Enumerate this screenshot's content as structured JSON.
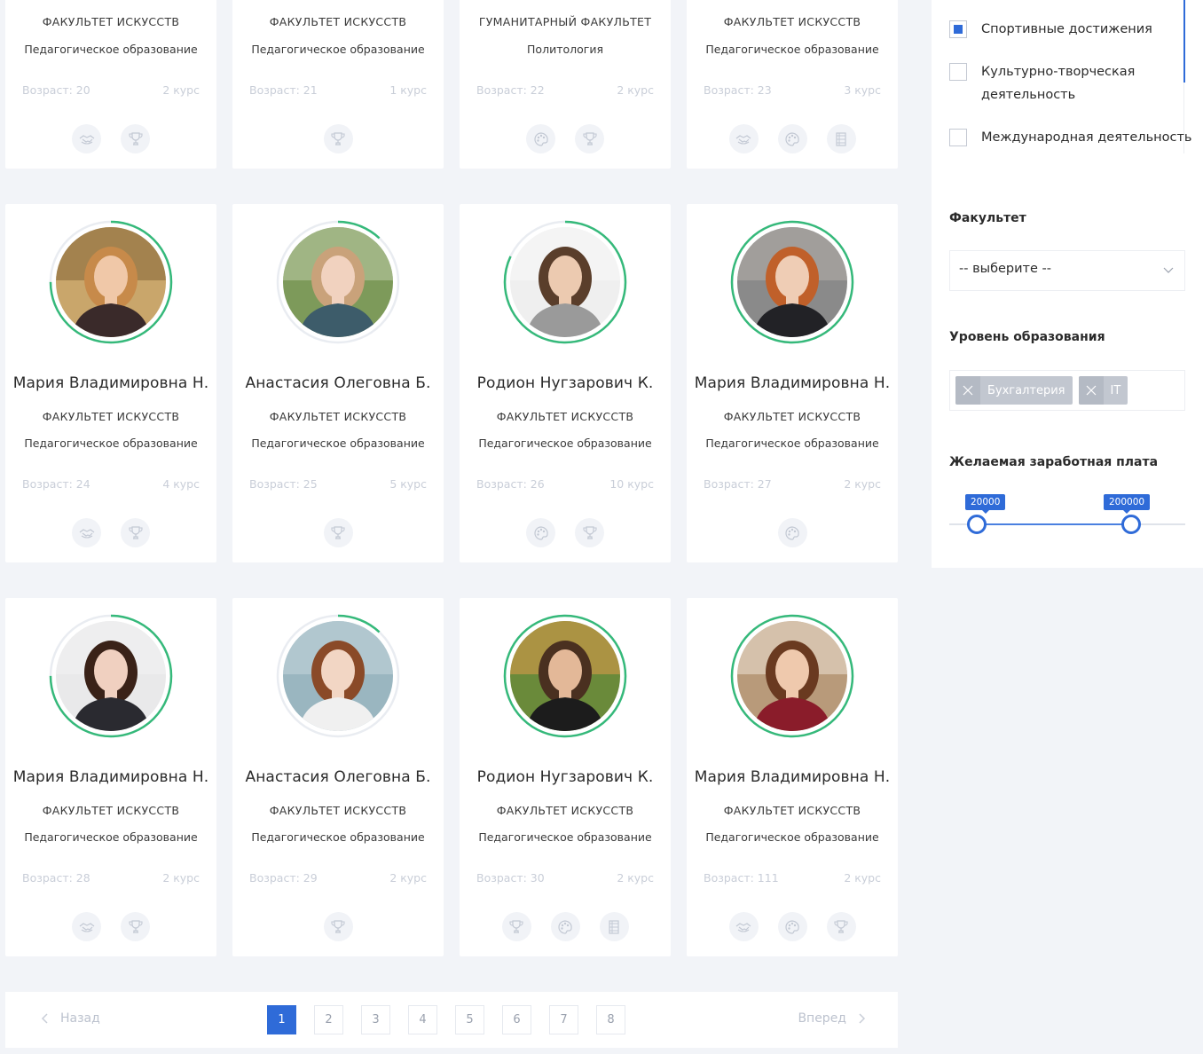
{
  "colors": {
    "accent": "#2f6bd8",
    "ring": "#35b97a",
    "muted": "#c9ced8"
  },
  "top_row": [
    {
      "faculty": "ФАКУЛЬТЕТ ИСКУССТВ",
      "program": "Педагогическое образование",
      "age": "Возраст: 20",
      "course": "2 курс",
      "badges": [
        "handshake-icon",
        "trophy-icon"
      ]
    },
    {
      "faculty": "ФАКУЛЬТЕТ ИСКУССТВ",
      "program": "Педагогическое образование",
      "age": "Возраст: 21",
      "course": "1 курс",
      "badges": [
        "trophy-icon"
      ]
    },
    {
      "faculty": "ГУМАНИТАРНЫЙ ФАКУЛЬТЕТ",
      "program": "Политология",
      "age": "Возраст: 22",
      "course": "2 курс",
      "badges": [
        "palette-icon",
        "trophy-icon"
      ]
    },
    {
      "faculty": "ФАКУЛЬТЕТ ИСКУССТВ",
      "program": "Педагогическое образование",
      "age": "Возраст: 23",
      "course": "3 курс",
      "badges": [
        "handshake-icon",
        "palette-icon",
        "film-icon"
      ]
    }
  ],
  "row2": [
    {
      "name": "Мария Владимировна Н.",
      "faculty": "ФАКУЛЬТЕТ ИСКУССТВ",
      "program": "Педагогическое образование",
      "age": "Возраст: 24",
      "course": "4 курс",
      "progress": 0.75,
      "badges": [
        "handshake-icon",
        "trophy-icon"
      ]
    },
    {
      "name": "Анастасия Олеговна Б.",
      "faculty": "ФАКУЛЬТЕТ ИСКУССТВ",
      "program": "Педагогическое образование",
      "age": "Возраст: 25",
      "course": "5 курс",
      "progress": 0.12,
      "badges": [
        "trophy-icon"
      ]
    },
    {
      "name": "Родион Нугзарович К.",
      "faculty": "ФАКУЛЬТЕТ ИСКУССТВ",
      "program": "Педагогическое образование",
      "age": "Возраст: 26",
      "course": "10 курс",
      "progress": 0.82,
      "badges": [
        "palette-icon",
        "trophy-icon"
      ]
    },
    {
      "name": "Мария Владимировна Н.",
      "faculty": "ФАКУЛЬТЕТ ИСКУССТВ",
      "program": "Педагогическое образование",
      "age": "Возраст: 27",
      "course": "2 курс",
      "progress": 1.0,
      "badges": [
        "palette-icon"
      ]
    }
  ],
  "row3": [
    {
      "name": "Мария Владимировна Н.",
      "faculty": "ФАКУЛЬТЕТ ИСКУССТВ",
      "program": "Педагогическое образование",
      "age": "Возраст: 28",
      "course": "2 курс",
      "progress": 0.75,
      "badges": [
        "handshake-icon",
        "trophy-icon"
      ]
    },
    {
      "name": "Анастасия Олеговна Б.",
      "faculty": "ФАКУЛЬТЕТ ИСКУССТВ",
      "program": "Педагогическое образование",
      "age": "Возраст: 29",
      "course": "2 курс",
      "progress": 0.12,
      "badges": [
        "trophy-icon"
      ]
    },
    {
      "name": "Родион Нугзарович К.",
      "faculty": "ФАКУЛЬТЕТ ИСКУССТВ",
      "program": "Педагогическое образование",
      "age": "Возраст: 30",
      "course": "2 курс",
      "progress": 1.0,
      "badges": [
        "trophy-icon",
        "palette-icon",
        "film-icon"
      ]
    },
    {
      "name": "Мария Владимировна Н.",
      "faculty": "ФАКУЛЬТЕТ ИСКУССТВ",
      "program": "Педагогическое образование",
      "age": "Возраст: 111",
      "course": "2 курс",
      "progress": 1.0,
      "badges": [
        "handshake-icon",
        "palette-icon",
        "trophy-icon"
      ]
    }
  ],
  "pagination": {
    "prev": "Назад",
    "next": "Вперед",
    "pages": [
      "1",
      "2",
      "3",
      "4",
      "5",
      "6",
      "7",
      "8"
    ],
    "active": "1"
  },
  "sidebar": {
    "activities": [
      {
        "label": "Спортивные достижения",
        "checked": true
      },
      {
        "label": "Культурно-творческая деятельность",
        "checked": false
      },
      {
        "label": "Международная деятельность",
        "checked": false
      }
    ],
    "faculty_title": "Факультет",
    "faculty_select": "-- выберите --",
    "education_title": "Уровень образования",
    "education_tags": [
      "Бухгалтерия",
      "IT"
    ],
    "salary_title": "Желаемая заработная плата",
    "salary_min": "20000",
    "salary_max": "200000"
  }
}
